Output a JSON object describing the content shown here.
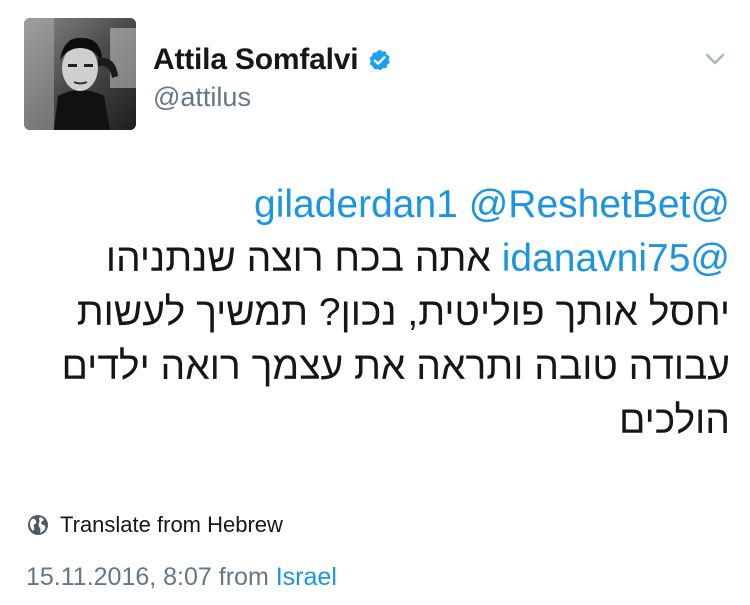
{
  "author": {
    "display_name": "Attila Somfalvi",
    "handle": "@attilus",
    "verified": true
  },
  "tweet": {
    "mentions": {
      "m1": "@giladerdan1",
      "m2": "@ReshetBet",
      "m3": "@idanavni75"
    },
    "text": {
      "line2_rest": "אתה בכח רוצה שנתניהו",
      "line3": "יחסל אותך פוליטית, נכון? תמשיך לעשות",
      "line4": "עבודה טובה ותראה את עצמך רואה ילדים",
      "line5": "הולכים"
    }
  },
  "translate": {
    "label": "Translate from Hebrew"
  },
  "meta": {
    "timestamp": "15.11.2016, 8:07",
    "from_word": "from",
    "place": "Israel"
  },
  "icons": {
    "verified": "verified-badge-icon",
    "chevron": "chevron-down-icon",
    "globe": "globe-icon"
  },
  "colors": {
    "link": "#1b95e0",
    "secondary_text": "#657786",
    "primary_text": "#14171a"
  }
}
